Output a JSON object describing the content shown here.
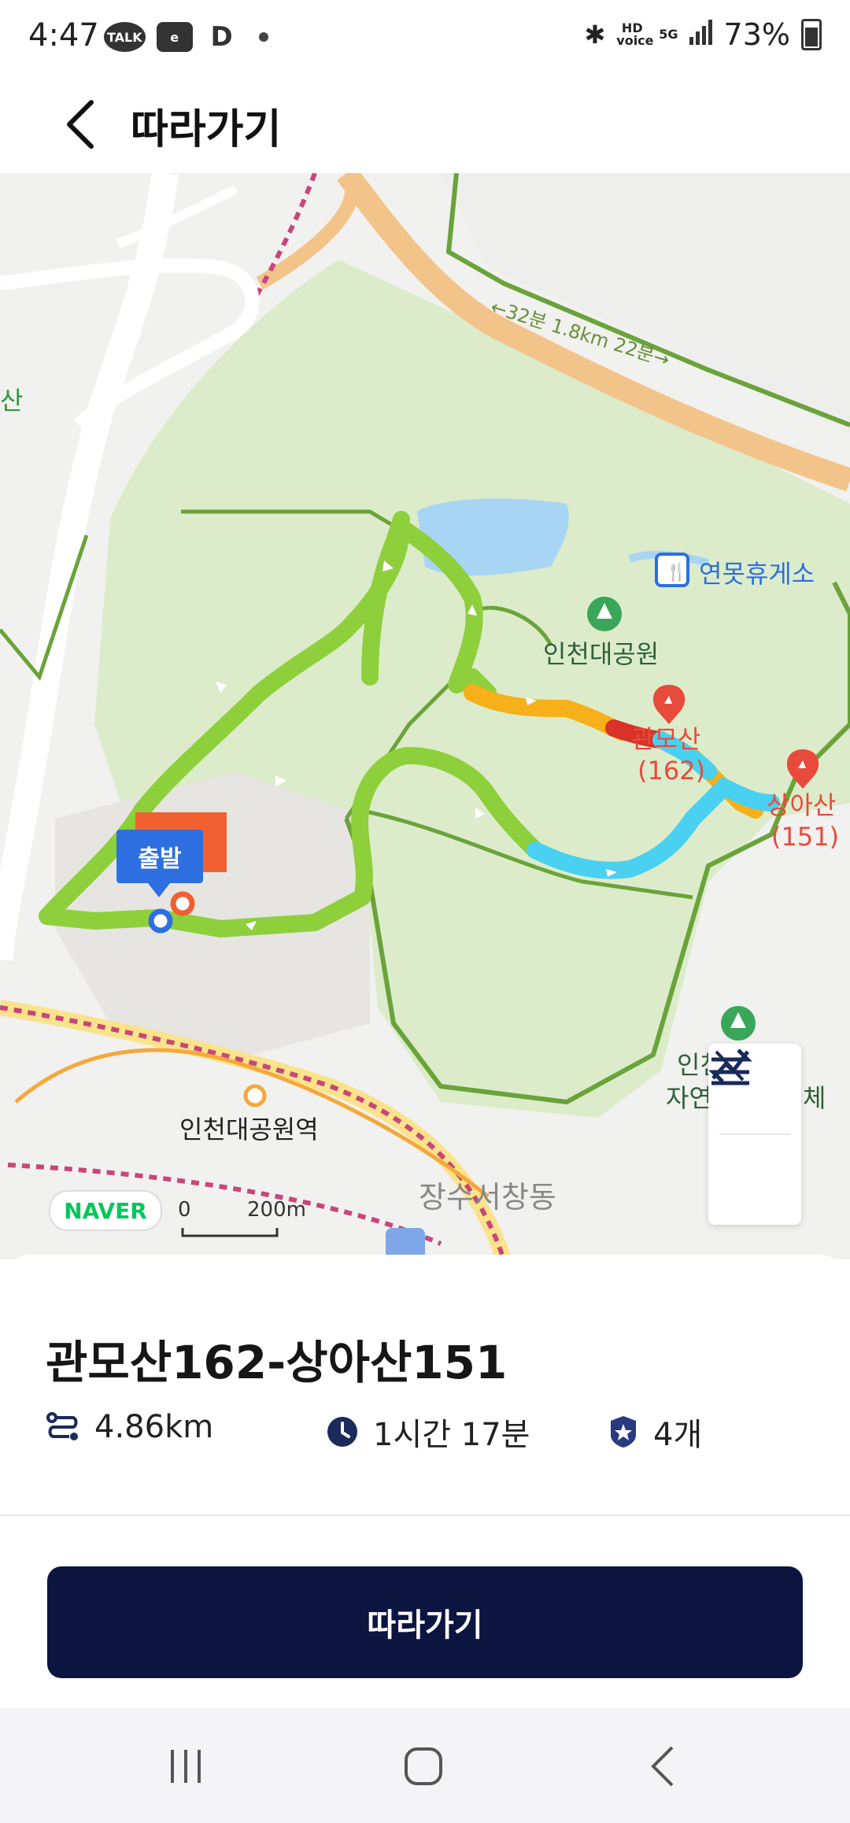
{
  "status_bar": {
    "time": "4:47",
    "left_icons": [
      "TALK",
      "e",
      "D"
    ],
    "hd_voice": "HD voice",
    "network": "5G",
    "battery": "73%"
  },
  "header": {
    "title": "따라가기",
    "back_icon": "chevron-left-icon"
  },
  "map": {
    "labels": {
      "road_time": "←32분 1.8km 22분→",
      "rest_area": "연못휴게소",
      "park": "인천대공원",
      "peak1_name": "관모산",
      "peak1_height": "(162)",
      "peak2_name": "상아산",
      "peak2_height": "(151)",
      "station": "인천대공원역",
      "district": "장수서창동",
      "partial_left": "산",
      "partial_right_1": "인천",
      "partial_right_2": "자연",
      "partial_right_3": "체"
    },
    "start_label": "출발",
    "naver_logo": "NAVER",
    "scale_zero": "0",
    "scale_distance": "200m",
    "controls": [
      "elevation-icon",
      "swap-icon"
    ]
  },
  "route": {
    "title": "관모산162-상아산151",
    "distance": "4.86km",
    "duration": "1시간 17분",
    "badge_count": "4개"
  },
  "cta_label": "따라가기",
  "nav_bar": [
    "recent-apps-icon",
    "home-icon",
    "back-icon"
  ],
  "colors": {
    "cta": "#0c1440",
    "route_green": "#8ecf3c",
    "route_blue": "#4ad0f0",
    "route_orange": "#f6b01a",
    "route_red": "#d8322a",
    "start_blue": "#2d6fe0",
    "peak_marker": "#e84a3c"
  }
}
